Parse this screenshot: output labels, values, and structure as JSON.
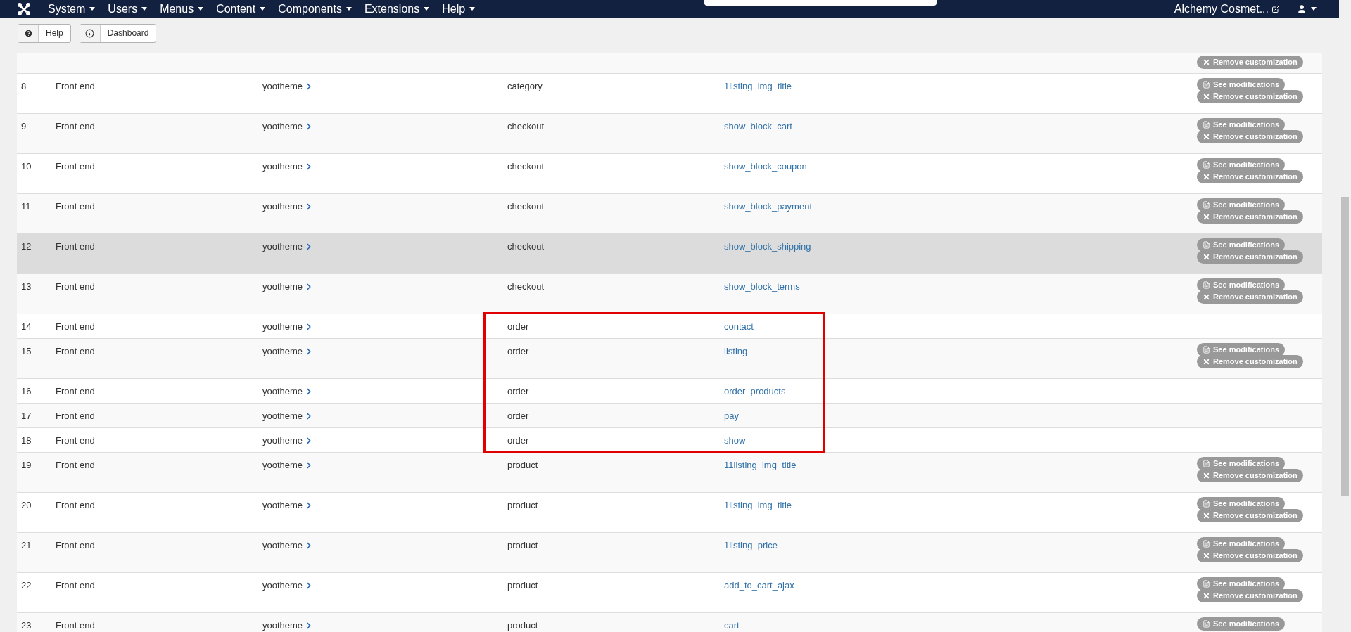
{
  "nav": {
    "menus": [
      {
        "label": "System"
      },
      {
        "label": "Users"
      },
      {
        "label": "Menus"
      },
      {
        "label": "Content"
      },
      {
        "label": "Components"
      },
      {
        "label": "Extensions"
      },
      {
        "label": "Help"
      }
    ],
    "site": "Alchemy Cosmet..."
  },
  "toolbar": {
    "buttons": [
      {
        "label": "Help",
        "kind": "help"
      },
      {
        "label": "Dashboard",
        "kind": "dashboard"
      }
    ]
  },
  "partial_row": {
    "actions": [
      {
        "kind": "remove",
        "label": "Remove customization"
      }
    ]
  },
  "rows": [
    {
      "number": "8",
      "client": "Front end",
      "template": "yootheme",
      "category": "category",
      "file": "1listing_img_title",
      "highlighted": false,
      "framed": false,
      "actions": [
        {
          "kind": "see",
          "label": "See modifications"
        },
        {
          "kind": "remove",
          "label": "Remove customization"
        }
      ]
    },
    {
      "number": "9",
      "client": "Front end",
      "template": "yootheme",
      "category": "checkout",
      "file": "show_block_cart",
      "highlighted": false,
      "framed": false,
      "actions": [
        {
          "kind": "see",
          "label": "See modifications"
        },
        {
          "kind": "remove",
          "label": "Remove customization"
        }
      ]
    },
    {
      "number": "10",
      "client": "Front end",
      "template": "yootheme",
      "category": "checkout",
      "file": "show_block_coupon",
      "highlighted": false,
      "framed": false,
      "actions": [
        {
          "kind": "see",
          "label": "See modifications"
        },
        {
          "kind": "remove",
          "label": "Remove customization"
        }
      ]
    },
    {
      "number": "11",
      "client": "Front end",
      "template": "yootheme",
      "category": "checkout",
      "file": "show_block_payment",
      "highlighted": false,
      "framed": false,
      "actions": [
        {
          "kind": "see",
          "label": "See modifications"
        },
        {
          "kind": "remove",
          "label": "Remove customization"
        }
      ]
    },
    {
      "number": "12",
      "client": "Front end",
      "template": "yootheme",
      "category": "checkout",
      "file": "show_block_shipping",
      "highlighted": true,
      "framed": false,
      "actions": [
        {
          "kind": "see",
          "label": "See modifications"
        },
        {
          "kind": "remove",
          "label": "Remove customization"
        }
      ]
    },
    {
      "number": "13",
      "client": "Front end",
      "template": "yootheme",
      "category": "checkout",
      "file": "show_block_terms",
      "highlighted": false,
      "framed": false,
      "actions": [
        {
          "kind": "see",
          "label": "See modifications"
        },
        {
          "kind": "remove",
          "label": "Remove customization"
        }
      ]
    },
    {
      "number": "14",
      "client": "Front end",
      "template": "yootheme",
      "category": "order",
      "file": "contact",
      "highlighted": false,
      "framed": true
    },
    {
      "number": "15",
      "client": "Front end",
      "template": "yootheme",
      "category": "order",
      "file": "listing",
      "highlighted": false,
      "framed": true,
      "actions": [
        {
          "kind": "see",
          "label": "See modifications"
        },
        {
          "kind": "remove",
          "label": "Remove customization"
        }
      ]
    },
    {
      "number": "16",
      "client": "Front end",
      "template": "yootheme",
      "category": "order",
      "file": "order_products",
      "highlighted": false,
      "framed": true
    },
    {
      "number": "17",
      "client": "Front end",
      "template": "yootheme",
      "category": "order",
      "file": "pay",
      "highlighted": false,
      "framed": true
    },
    {
      "number": "18",
      "client": "Front end",
      "template": "yootheme",
      "category": "order",
      "file": "show",
      "highlighted": false,
      "framed": true
    },
    {
      "number": "19",
      "client": "Front end",
      "template": "yootheme",
      "category": "product",
      "file": "11listing_img_title",
      "highlighted": false,
      "framed": false,
      "actions": [
        {
          "kind": "see",
          "label": "See modifications"
        },
        {
          "kind": "remove",
          "label": "Remove customization"
        }
      ]
    },
    {
      "number": "20",
      "client": "Front end",
      "template": "yootheme",
      "category": "product",
      "file": "1listing_img_title",
      "highlighted": false,
      "framed": false,
      "actions": [
        {
          "kind": "see",
          "label": "See modifications"
        },
        {
          "kind": "remove",
          "label": "Remove customization"
        }
      ]
    },
    {
      "number": "21",
      "client": "Front end",
      "template": "yootheme",
      "category": "product",
      "file": "1listing_price",
      "highlighted": false,
      "framed": false,
      "actions": [
        {
          "kind": "see",
          "label": "See modifications"
        },
        {
          "kind": "remove",
          "label": "Remove customization"
        }
      ]
    },
    {
      "number": "22",
      "client": "Front end",
      "template": "yootheme",
      "category": "product",
      "file": "add_to_cart_ajax",
      "highlighted": false,
      "framed": false,
      "actions": [
        {
          "kind": "see",
          "label": "See modifications"
        },
        {
          "kind": "remove",
          "label": "Remove customization"
        }
      ]
    },
    {
      "number": "23",
      "client": "Front end",
      "template": "yootheme",
      "category": "product",
      "file": "cart",
      "highlighted": false,
      "framed": false,
      "actions": [
        {
          "kind": "see",
          "label": "See modifications"
        }
      ]
    }
  ]
}
